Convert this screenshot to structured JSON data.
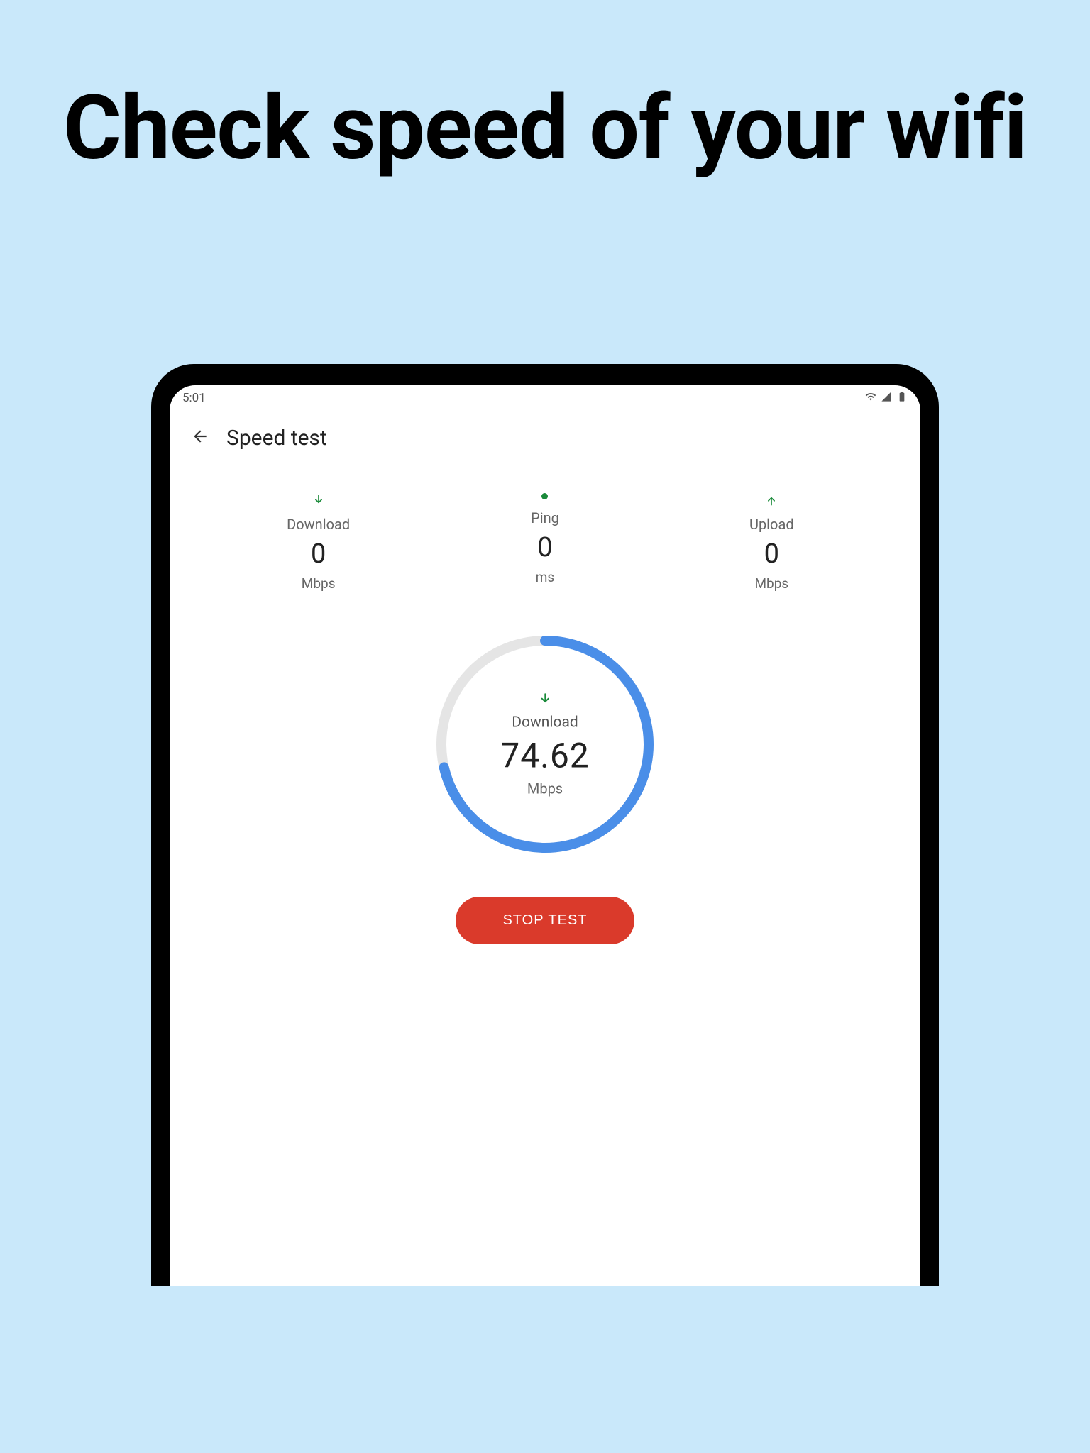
{
  "header": {
    "title": "Check speed of your wifi"
  },
  "status_bar": {
    "time": "5:01"
  },
  "app_bar": {
    "title": "Speed test"
  },
  "metrics": {
    "download": {
      "label": "Download",
      "value": "0",
      "unit": "Mbps"
    },
    "ping": {
      "label": "Ping",
      "value": "0",
      "unit": "ms"
    },
    "upload": {
      "label": "Upload",
      "value": "0",
      "unit": "Mbps"
    }
  },
  "gauge": {
    "label": "Download",
    "value": "74.62",
    "unit": "Mbps",
    "progress_percent": 71
  },
  "button": {
    "stop_label": "STOP TEST"
  },
  "colors": {
    "background": "#c9e8fa",
    "accent_green": "#1a8a3a",
    "accent_blue": "#4a8ee8",
    "accent_red": "#da3a2b"
  }
}
